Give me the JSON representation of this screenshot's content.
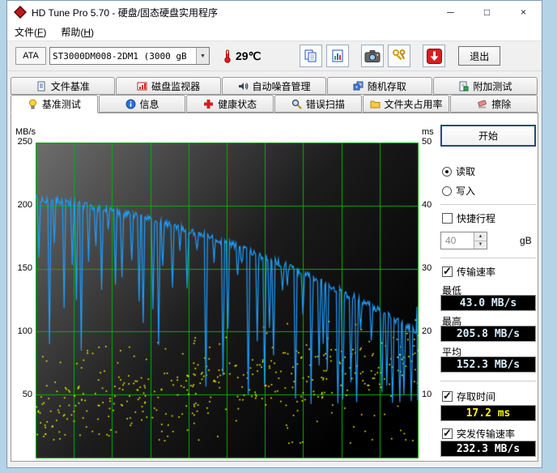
{
  "window": {
    "title": "HD Tune Pro 5.70 - 硬盘/固态硬盘实用程序",
    "minimize_glyph": "─",
    "maximize_glyph": "□",
    "close_glyph": "×"
  },
  "menu": {
    "file": "文件(F)",
    "help": "帮助(H)"
  },
  "toolbar": {
    "interface_label": "ATA",
    "drive_selected": "ST3000DM008-2DM1 (3000 gB",
    "temperature": "29℃",
    "exit_label": "退出"
  },
  "tabs": {
    "row1": [
      {
        "label": "文件基准",
        "icon": "file-benchmark"
      },
      {
        "label": "磁盘监视器",
        "icon": "disk-monitor"
      },
      {
        "label": "自动噪音管理",
        "icon": "noise-management"
      },
      {
        "label": "随机存取",
        "icon": "random-access"
      },
      {
        "label": "附加测试",
        "icon": "extra-tests"
      }
    ],
    "row2": [
      {
        "label": "基准测试",
        "icon": "benchmark",
        "active": true
      },
      {
        "label": "信息",
        "icon": "info"
      },
      {
        "label": "健康状态",
        "icon": "health"
      },
      {
        "label": "错误扫描",
        "icon": "error-scan"
      },
      {
        "label": "文件夹占用率",
        "icon": "folder-usage"
      },
      {
        "label": "擦除",
        "icon": "erase"
      }
    ]
  },
  "controls": {
    "start_label": "开始",
    "mode": {
      "read_label": "读取",
      "write_label": "写入",
      "read_selected": true,
      "write_selected": false
    },
    "short_stroke": {
      "label": "快捷行程",
      "checked": false,
      "value": "40",
      "unit": "gB"
    },
    "transfer_rate": {
      "label": "传输速率",
      "checked": true,
      "min_label": "最低",
      "min_value": "43.0 MB/s",
      "max_label": "最高",
      "max_value": "205.8 MB/s",
      "avg_label": "平均",
      "avg_value": "152.3 MB/s"
    },
    "access_time": {
      "label": "存取时间",
      "checked": true,
      "value": "17.2 ms"
    },
    "burst_rate": {
      "label": "突发传输速率",
      "checked": true,
      "value": "232.3 MB/s"
    },
    "value_colors": {
      "transfer": "#d9f0ff",
      "access": "#ffff00",
      "burst": "#ffffff"
    }
  },
  "chart_data": {
    "type": "line+scatter",
    "y_left": {
      "unit": "MB/s",
      "ticks": [
        250,
        200,
        150,
        100,
        50
      ],
      "range": [
        0,
        250
      ]
    },
    "y_right": {
      "unit": "ms",
      "ticks": [
        50,
        40,
        30,
        20,
        10
      ],
      "range": [
        0,
        50
      ]
    },
    "grid": {
      "v_divisions": 10,
      "h_divisions": 5,
      "color": "#00b400"
    },
    "background": {
      "gradient_from": "#6e6e6e",
      "gradient_mid": "#1c1c1c",
      "gradient_to": "#000000"
    },
    "series": [
      {
        "name": "transfer-rate",
        "type": "line",
        "color": "#1e9fff",
        "start_mbps": 205,
        "end_mbps": 100,
        "min_mbps": 43.0,
        "max_mbps": 205.8,
        "avg_mbps": 152.3,
        "shape": "downward-sloping envelope with frequent deep downward spikes, final plunge to minimum at right edge"
      },
      {
        "name": "access-time",
        "type": "scatter",
        "color": "#ffff00",
        "min_ms": 2.5,
        "max_ms": 22,
        "avg_ms": 17.2,
        "shape": "dense yellow dot band rising slightly left to right in lower third"
      }
    ],
    "burst_rate_mbps": 232.3,
    "seed": 20577
  }
}
